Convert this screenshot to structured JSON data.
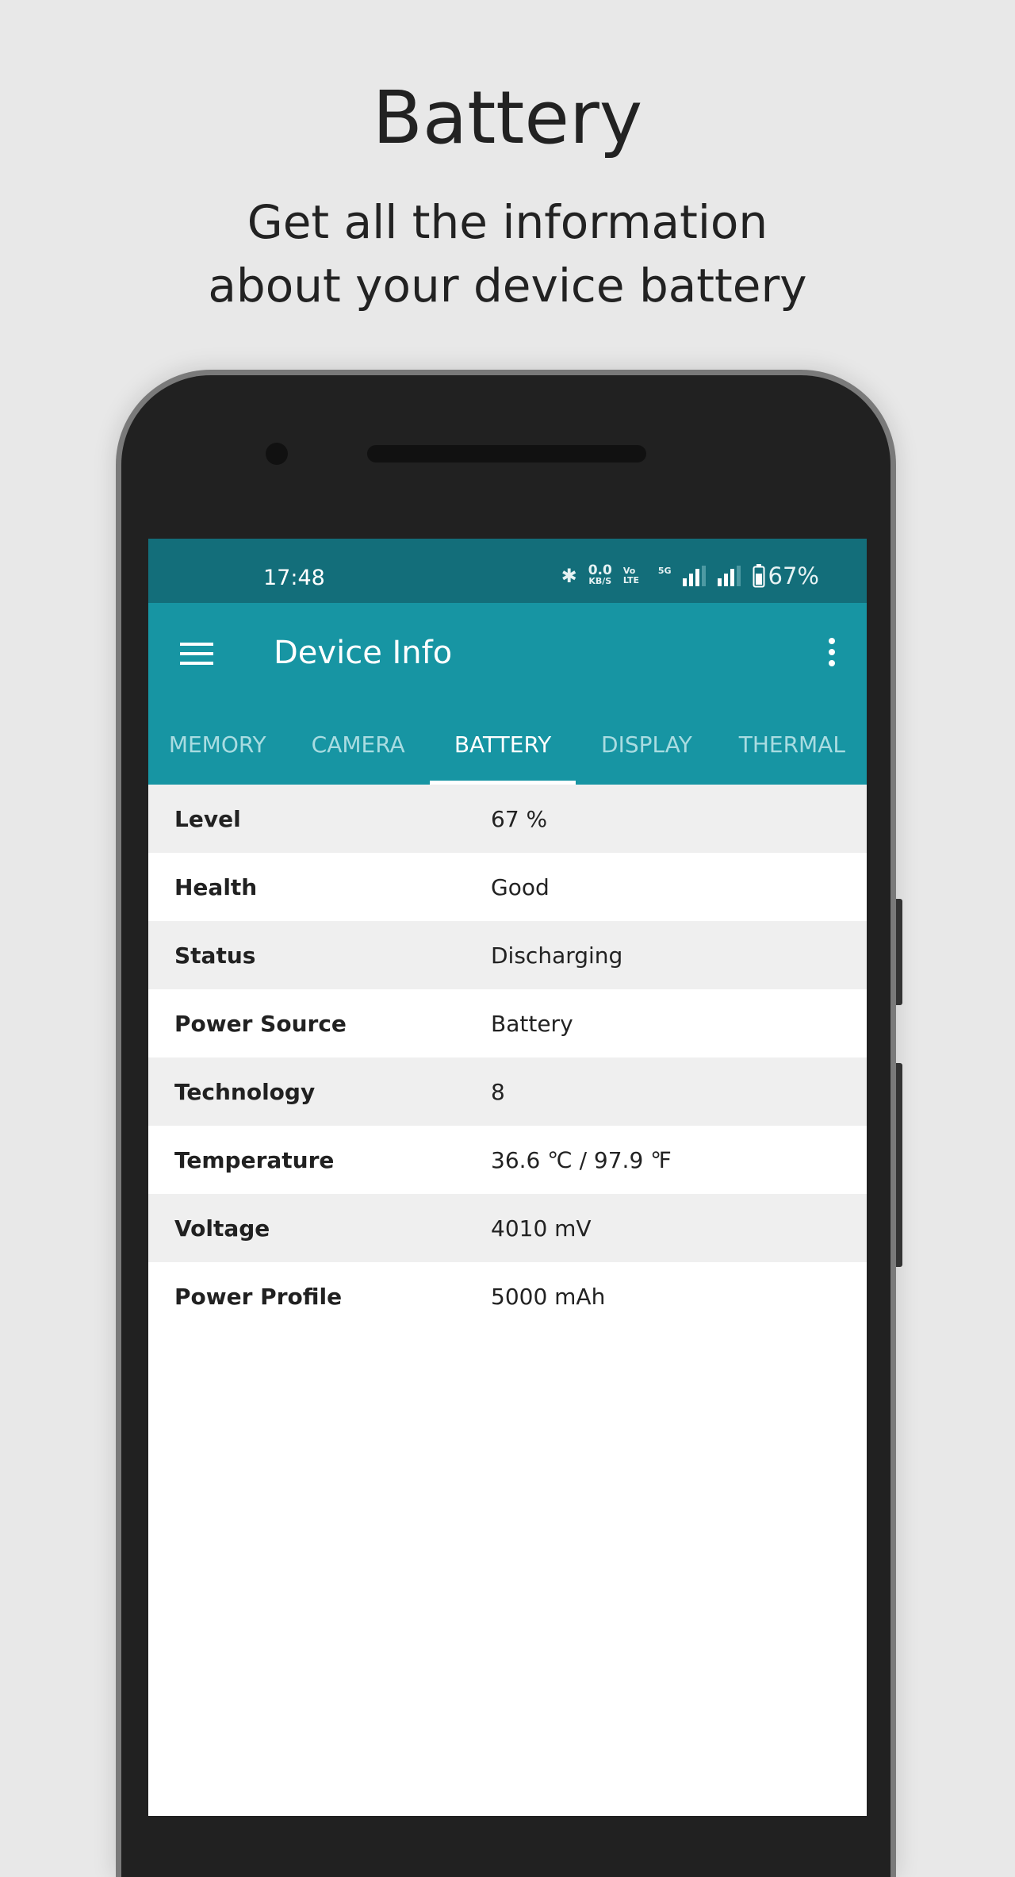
{
  "hero": {
    "title": "Battery",
    "subtitle": "Get all the information about your device battery"
  },
  "status_bar": {
    "time": "17:48",
    "net_speed": "0.0",
    "net_unit": "KB/S",
    "volte": "Vo LTE",
    "network": "5G",
    "battery": "67%"
  },
  "toolbar": {
    "title": "Device Info",
    "menu_icon": "hamburger-icon",
    "more_icon": "more-vert-icon"
  },
  "tabs": [
    {
      "label": "MEMORY"
    },
    {
      "label": "CAMERA"
    },
    {
      "label": "BATTERY",
      "active": true
    },
    {
      "label": "DISPLAY"
    },
    {
      "label": "THERMAL"
    }
  ],
  "rows": [
    {
      "key": "Level",
      "value": "67 %"
    },
    {
      "key": "Health",
      "value": "Good"
    },
    {
      "key": "Status",
      "value": "Discharging"
    },
    {
      "key": "Power Source",
      "value": "Battery"
    },
    {
      "key": "Technology",
      "value": "8"
    },
    {
      "key": "Temperature",
      "value": "36.6 ℃ / 97.9 ℉"
    },
    {
      "key": "Voltage",
      "value": "4010 mV"
    },
    {
      "key": "Power Profile",
      "value": "5000 mAh"
    }
  ],
  "colors": {
    "status_bar": "#136e7a",
    "toolbar": "#1795a3",
    "background": "#e8e8e8"
  }
}
